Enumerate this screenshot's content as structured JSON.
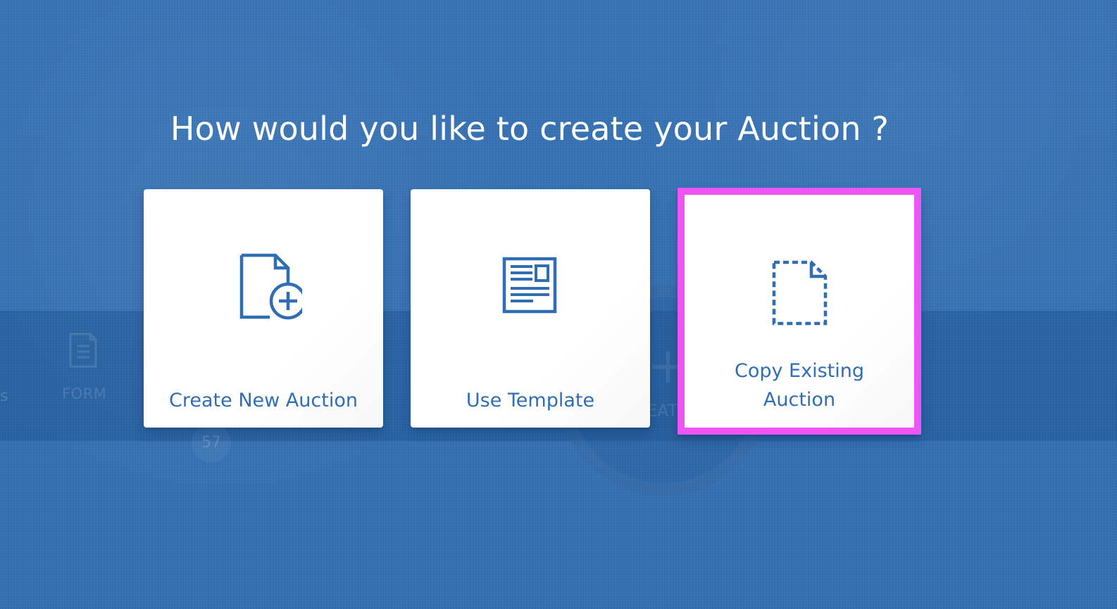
{
  "page": {
    "title": "How would you like to create your Auction ?"
  },
  "options": [
    {
      "id": "create-new",
      "label": "Create New Auction",
      "icon": "document-plus-icon"
    },
    {
      "id": "use-template",
      "label": "Use Template",
      "icon": "template-icon"
    },
    {
      "id": "copy-existing",
      "label": "Copy Existing\nAuction",
      "icon": "dashed-document-icon",
      "selected": true
    }
  ],
  "background": {
    "form_label": "FORM",
    "number_badge": "57",
    "partial_text": "EAT"
  },
  "colors": {
    "page_bg": "#336fb0",
    "card_bg": "#ffffff",
    "accent": "#2f6db4",
    "highlight": "#ef55f4"
  }
}
